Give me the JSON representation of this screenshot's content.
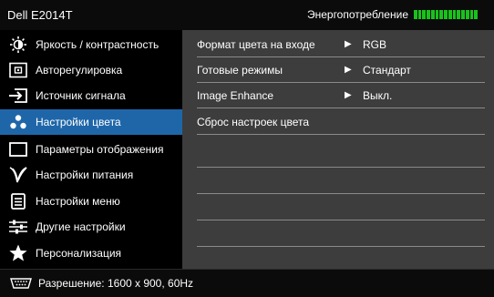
{
  "header": {
    "model": "Dell E2014T",
    "energy_label": "Энергопотребление",
    "energy_color": "#19c21b"
  },
  "sidebar": {
    "items": [
      {
        "label": "Яркость / контрастность",
        "icon": "brightness-icon"
      },
      {
        "label": "Авторегулировка",
        "icon": "auto-adjust-icon"
      },
      {
        "label": "Источник сигнала",
        "icon": "input-source-icon"
      },
      {
        "label": "Настройки цвета",
        "icon": "color-settings-icon",
        "active": true
      },
      {
        "label": "Параметры отображения",
        "icon": "display-settings-icon"
      },
      {
        "label": "Настройки питания",
        "icon": "power-settings-icon"
      },
      {
        "label": "Настройки меню",
        "icon": "menu-settings-icon"
      },
      {
        "label": "Другие настройки",
        "icon": "other-settings-icon"
      },
      {
        "label": "Персонализация",
        "icon": "star-icon"
      }
    ]
  },
  "panel": {
    "rows": [
      {
        "name": "Формат цвета на входе",
        "value": "RGB"
      },
      {
        "name": "Готовые режимы",
        "value": "Стандарт"
      },
      {
        "name": "Image Enhance",
        "value": "Выкл."
      },
      {
        "name": "Сброс настроек цвета",
        "value": ""
      }
    ]
  },
  "footer": {
    "resolution": "Разрешение: 1600 x 900, 60Hz",
    "icon": "vga-connector-icon"
  },
  "colors": {
    "active_bg": "#1f66a9",
    "panel_bg": "#3d3d3d",
    "separator": "#8a8a8a"
  }
}
